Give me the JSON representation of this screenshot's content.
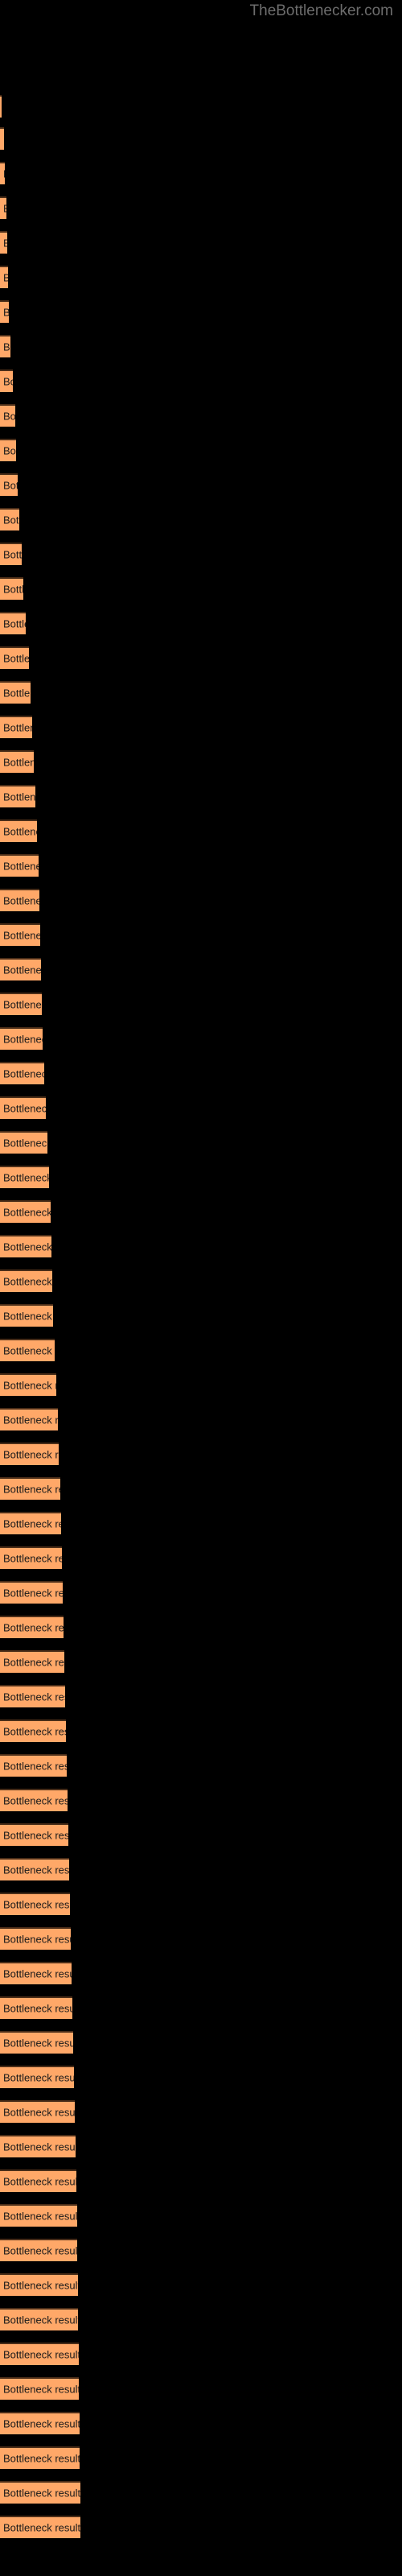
{
  "watermark": {
    "text": "TheBottlenecker.com",
    "color": "#6d6d6d"
  },
  "colors": {
    "background": "#000000",
    "bar_fill": "#ffa868",
    "bar_border": "#4a2d18",
    "bar_label": "#1a1a1a",
    "watermark": "#6d6d6d"
  },
  "chart_data": {
    "type": "bar",
    "orientation": "horizontal",
    "title": "",
    "subtitle": "",
    "xlabel": "",
    "ylabel": "",
    "grid": false,
    "legend": false,
    "axis_labels_visible": false,
    "bar_label_text": "Bottleneck result",
    "xlim": [
      0,
      500
    ],
    "categories": [
      "Bottleneck result",
      "Bottleneck result",
      "Bottleneck result",
      "Bottleneck result",
      "Bottleneck result",
      "Bottleneck result",
      "Bottleneck result",
      "Bottleneck result",
      "Bottleneck result",
      "Bottleneck result",
      "Bottleneck result",
      "Bottleneck result",
      "Bottleneck result",
      "Bottleneck result",
      "Bottleneck result",
      "Bottleneck result",
      "Bottleneck result",
      "Bottleneck result",
      "Bottleneck result",
      "Bottleneck result",
      "Bottleneck result",
      "Bottleneck result",
      "Bottleneck result",
      "Bottleneck result",
      "Bottleneck result",
      "Bottleneck result",
      "Bottleneck result",
      "Bottleneck result",
      "Bottleneck result",
      "Bottleneck result",
      "Bottleneck result",
      "Bottleneck result",
      "Bottleneck result",
      "Bottleneck result",
      "Bottleneck result",
      "Bottleneck result",
      "Bottleneck result",
      "Bottleneck result",
      "Bottleneck result",
      "Bottleneck result",
      "Bottleneck result",
      "Bottleneck result",
      "Bottleneck result",
      "Bottleneck result",
      "Bottleneck result",
      "Bottleneck result",
      "Bottleneck result",
      "Bottleneck result",
      "Bottleneck result",
      "Bottleneck result",
      "Bottleneck result",
      "Bottleneck result",
      "Bottleneck result",
      "Bottleneck result",
      "Bottleneck result",
      "Bottleneck result",
      "Bottleneck result",
      "Bottleneck result",
      "Bottleneck result",
      "Bottleneck result",
      "Bottleneck result",
      "Bottleneck result",
      "Bottleneck result",
      "Bottleneck result",
      "Bottleneck result",
      "Bottleneck result",
      "Bottleneck result",
      "Bottleneck result",
      "Bottleneck result",
      "Bottleneck result",
      "Bottleneck result"
    ],
    "values": [
      2,
      5,
      6,
      8,
      9,
      10,
      11,
      13,
      16,
      19,
      20,
      22,
      24,
      27,
      29,
      32,
      36,
      38,
      40,
      42,
      44,
      46,
      48,
      49,
      50,
      51,
      52,
      53,
      55,
      57,
      59,
      61,
      63,
      64,
      65,
      66,
      68,
      70,
      72,
      73,
      75,
      76,
      77,
      78,
      79,
      80,
      81,
      82,
      83,
      84,
      85,
      86,
      87,
      88,
      89,
      90,
      91,
      92,
      93,
      94,
      95,
      96,
      96,
      97,
      97,
      98,
      98,
      99,
      99,
      100,
      100
    ],
    "bar_tops": [
      118,
      158,
      201,
      244,
      287,
      330,
      373,
      416,
      459,
      502,
      545,
      588,
      631,
      674,
      717,
      760,
      803,
      846,
      889,
      932,
      975,
      1018,
      1061,
      1104,
      1147,
      1190,
      1233,
      1276,
      1319,
      1362,
      1405,
      1448,
      1491,
      1534,
      1577,
      1620,
      1663,
      1706,
      1749,
      1792,
      1835,
      1878,
      1921,
      1964,
      2007,
      2050,
      2093,
      2136,
      2179,
      2222,
      2265,
      2308,
      2351,
      2394,
      2437,
      2480,
      2523,
      2566,
      2609,
      2652,
      2695,
      2738,
      2781,
      2824,
      2867,
      2910,
      2953,
      2996,
      3039,
      3082,
      3125
    ]
  }
}
